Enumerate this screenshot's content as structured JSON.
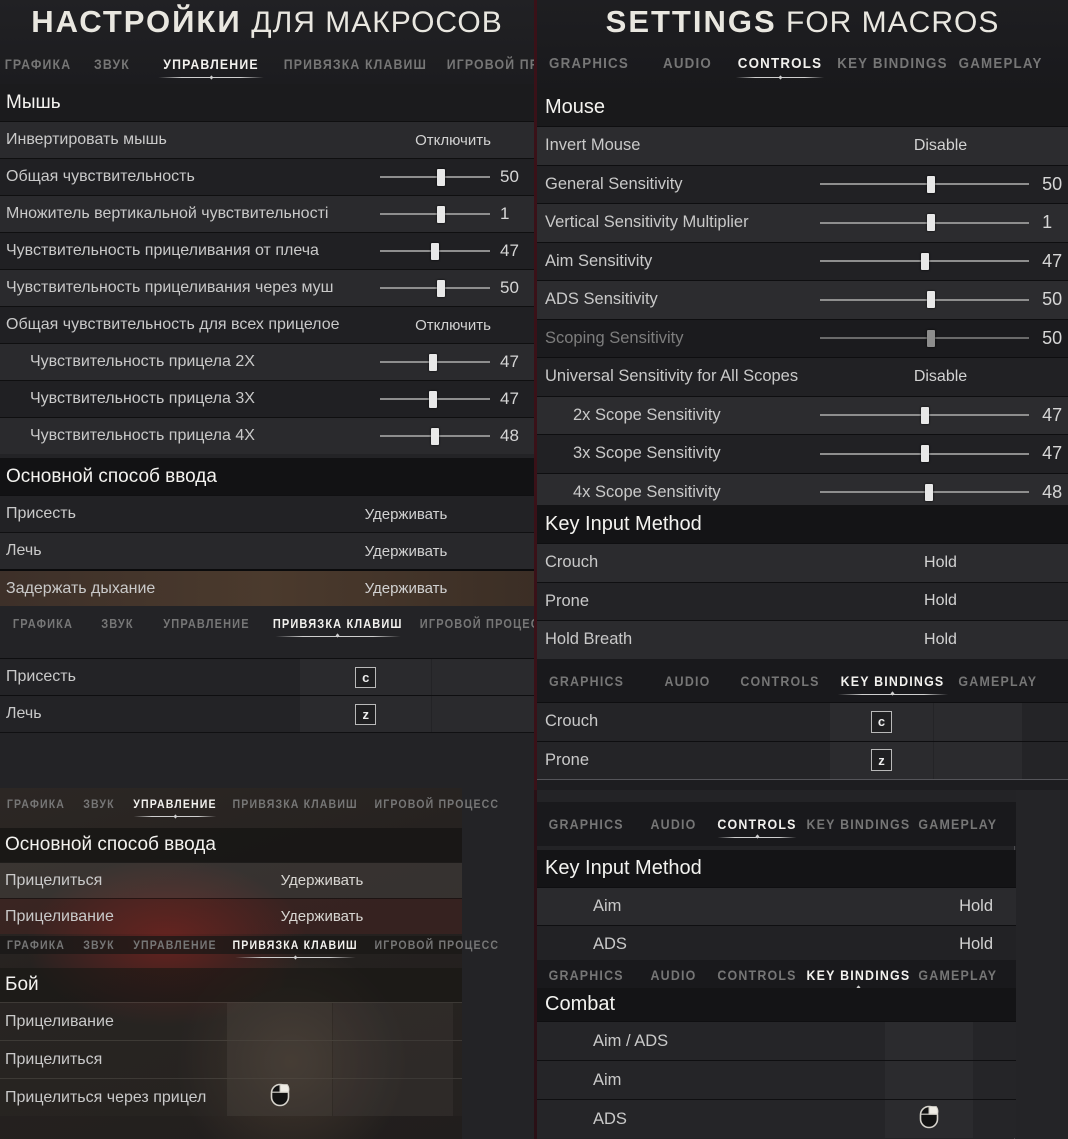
{
  "left": {
    "title_strong": "НАСТРОЙКИ",
    "title_light": "ДЛЯ МАКРОСОВ",
    "tabs": [
      "ГРАФИКА",
      "ЗВУК",
      "УПРАВЛЕНИЕ",
      "ПРИВЯЗКА КЛАВИШ",
      "ИГРОВОЙ ПРОЦЕСС"
    ],
    "active_tab": "УПРАВЛЕНИЕ",
    "section_mouse": "Мышь",
    "mouse_rows": [
      {
        "label": "Инвертировать мышь",
        "value": "Отключить",
        "type": "toggle"
      },
      {
        "label": "Общая чувствительность",
        "value": "50",
        "type": "slider",
        "pos": 55
      },
      {
        "label": "Множитель вертикальной чувствительності",
        "value": "1",
        "type": "slider",
        "pos": 55
      },
      {
        "label": "Чувствительность прицеливания от плеча",
        "value": "47",
        "type": "slider",
        "pos": 50
      },
      {
        "label": "Чувствительность прицеливания через муш",
        "value": "50",
        "type": "slider",
        "pos": 55
      },
      {
        "label": "Общая чувствительность для всех прицелое",
        "value": "Отключить",
        "type": "toggle"
      },
      {
        "label": "Чувствительность прицела 2X",
        "value": "47",
        "type": "slider",
        "pos": 48,
        "indent": true
      },
      {
        "label": "Чувствительность прицела 3X",
        "value": "47",
        "type": "slider",
        "pos": 48,
        "indent": true
      },
      {
        "label": "Чувствительность прицела 4X",
        "value": "48",
        "type": "slider",
        "pos": 50,
        "indent": true
      }
    ],
    "section_input": "Основной способ ввода",
    "input_rows": [
      {
        "label": "Присесть",
        "value": "Удерживать"
      },
      {
        "label": "Лечь",
        "value": "Удерживать"
      },
      {
        "label": "Задержать дыхание",
        "value": "Удерживать"
      }
    ],
    "tabs2_active": "ПРИВЯЗКА КЛАВИШ",
    "keybind_rows": [
      {
        "label": "Присесть",
        "key": "c"
      },
      {
        "label": "Лечь",
        "key": "z"
      }
    ],
    "lower": {
      "tabs_active": "УПРАВЛЕНИЕ",
      "section": "Основной способ ввода",
      "rows": [
        {
          "label": "Прицелиться",
          "value": "Удерживать"
        },
        {
          "label": "Прицеливание",
          "value": "Удерживать"
        }
      ],
      "tabs2_active": "ПРИВЯЗКА КЛАВИШ",
      "section2": "Бой",
      "rows2": [
        {
          "label": "Прицеливание",
          "key": ""
        },
        {
          "label": "Прицелиться",
          "key": ""
        },
        {
          "label": "Прицелиться через прицел",
          "key": "mouse-right-icon"
        }
      ]
    }
  },
  "right": {
    "title_strong": "SETTINGS",
    "title_light": "FOR MACROS",
    "tabs": [
      "GRAPHICS",
      "AUDIO",
      "CONTROLS",
      "KEY BINDINGS",
      "GAMEPLAY"
    ],
    "active_tab": "CONTROLS",
    "section_mouse": "Mouse",
    "mouse_rows": [
      {
        "label": "Invert Mouse",
        "value": "Disable",
        "type": "toggle"
      },
      {
        "label": "General Sensitivity",
        "value": "50",
        "type": "slider",
        "pos": 53
      },
      {
        "label": "Vertical Sensitivity Multiplier",
        "value": "1",
        "type": "slider",
        "pos": 53
      },
      {
        "label": "Aim Sensitivity",
        "value": "47",
        "type": "slider",
        "pos": 50
      },
      {
        "label": "ADS Sensitivity",
        "value": "50",
        "type": "slider",
        "pos": 53
      },
      {
        "label": "Scoping Sensitivity",
        "value": "50",
        "type": "slider",
        "pos": 53,
        "dim": true
      },
      {
        "label": "Universal Sensitivity for All Scopes",
        "value": "Disable",
        "type": "toggle"
      },
      {
        "label": "2x Scope Sensitivity",
        "value": "47",
        "type": "slider",
        "pos": 50,
        "indent": true
      },
      {
        "label": "3x Scope Sensitivity",
        "value": "47",
        "type": "slider",
        "pos": 50,
        "indent": true
      },
      {
        "label": "4x Scope Sensitivity",
        "value": "48",
        "type": "slider",
        "pos": 52,
        "indent": true
      }
    ],
    "section_key_input": "Key Input Method",
    "key_input_rows": [
      {
        "label": "Crouch",
        "value": "Hold"
      },
      {
        "label": "Prone",
        "value": "Hold"
      },
      {
        "label": "Hold Breath",
        "value": "Hold"
      }
    ],
    "tabs2_active": "KEY BINDINGS",
    "keybind_rows": [
      {
        "label": "Crouch",
        "key": "c"
      },
      {
        "label": "Prone",
        "key": "z"
      }
    ],
    "lower": {
      "tabs_active": "CONTROLS",
      "section": "Key Input Method",
      "rows": [
        {
          "label": "Aim",
          "value": "Hold"
        },
        {
          "label": "ADS",
          "value": "Hold"
        }
      ],
      "tabs2_active": "KEY BINDINGS",
      "section2": "Combat",
      "rows2": [
        {
          "label": "Aim / ADS",
          "key": ""
        },
        {
          "label": "Aim",
          "key": ""
        },
        {
          "label": "ADS",
          "key": "mouse-right-icon"
        }
      ]
    }
  },
  "colors": {
    "panel_bg": "#232326",
    "row_alt": "#2a2a2d",
    "accent_border": "#3a1118",
    "text_primary": "#f2f1ee",
    "text_secondary": "#c9c9c9",
    "text_dim": "#7d7d7d"
  }
}
